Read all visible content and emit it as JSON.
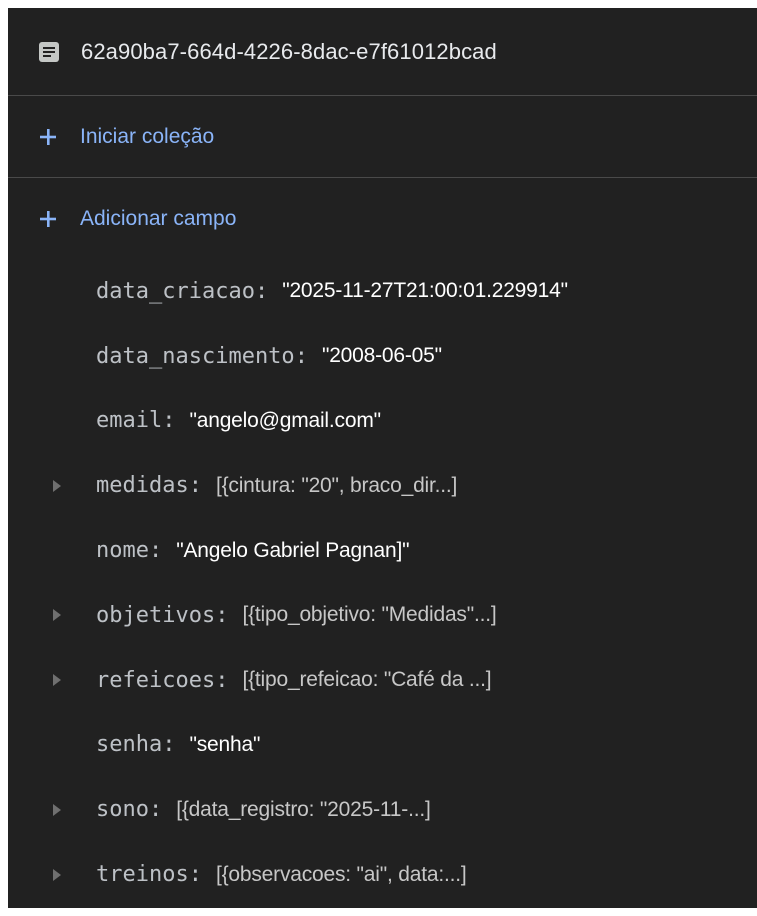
{
  "document": {
    "id": "62a90ba7-664d-4226-8dac-e7f61012bcad",
    "icon": "document-icon"
  },
  "actions": {
    "start_collection": "Iniciar coleção",
    "add_field": "Adicionar campo"
  },
  "fields": [
    {
      "key": "data_criacao",
      "value": "\"2025-11-27T21:00:01.229914\"",
      "expandable": false
    },
    {
      "key": "data_nascimento",
      "value": "\"2008-06-05\"",
      "expandable": false
    },
    {
      "key": "email",
      "value": "\"angelo@gmail.com\"",
      "expandable": false
    },
    {
      "key": "medidas",
      "value": "[{cintura: \"20\", braco_dir...]",
      "expandable": true
    },
    {
      "key": "nome",
      "value": "\"Angelo Gabriel Pagnan]\"",
      "expandable": false
    },
    {
      "key": "objetivos",
      "value": "[{tipo_objetivo: \"Medidas\"...]",
      "expandable": true
    },
    {
      "key": "refeicoes",
      "value": "[{tipo_refeicao: \"Café da ...]",
      "expandable": true
    },
    {
      "key": "senha",
      "value": "\"senha\"",
      "expandable": false
    },
    {
      "key": "sono",
      "value": "[{data_registro: \"2025-11-...]",
      "expandable": true
    },
    {
      "key": "treinos",
      "value": "[{observacoes: \"ai\", data:...]",
      "expandable": true
    }
  ],
  "colors": {
    "background": "#212121",
    "accent": "#8ab4f8",
    "key_text": "#bdc1c6",
    "value_text": "#ffffff"
  }
}
